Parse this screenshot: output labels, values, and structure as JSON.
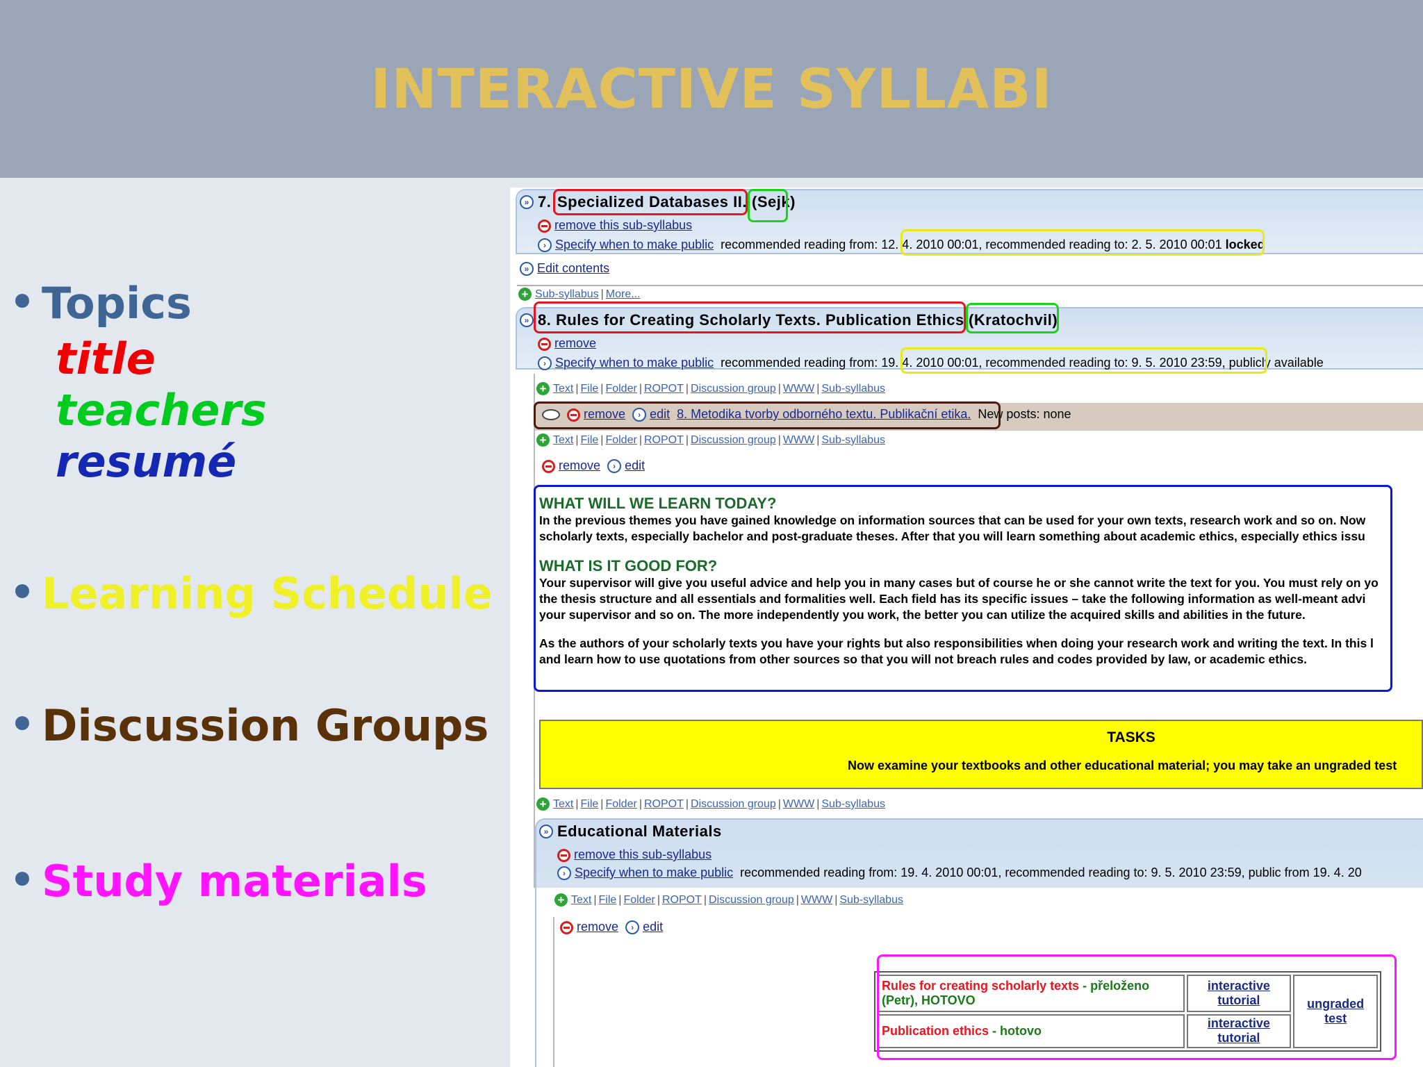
{
  "slide": {
    "title": "INTERACTIVE SYLLABI",
    "bullets": {
      "topics": "Topics",
      "topics_sub": [
        "title",
        "teachers",
        "resumé"
      ],
      "schedule": "Learning Schedule",
      "discussion": "Discussion Groups",
      "study": "Study materials"
    },
    "colors": {
      "header_bg": "#9aa6b7",
      "title": "#e2c15a",
      "topics": "#3e6594",
      "title_word": "#f00000",
      "teachers_word": "#00cc20",
      "resume_word": "#1428b4",
      "schedule": "#f0f028",
      "discussion": "#5a320a",
      "study": "#ff14ff"
    }
  },
  "screen": {
    "section7": {
      "number": "7.",
      "name": "Specialized Databases II.",
      "teacher": "(Sejk)",
      "remove": "remove this sub-syllabus",
      "specify": "Specify when to make public",
      "reading_label": "recommended reading from:",
      "reading_range": "12. 4. 2010 00:01, recommended reading to: 2. 5. 2010 00:01",
      "status": "locked",
      "edit_contents": "Edit contents",
      "sub_links": [
        "Sub-syllabus",
        "More..."
      ]
    },
    "section8": {
      "name": "8. Rules for Creating Scholarly Texts. Publication Ethics",
      "teacher": "(Kratochvil)",
      "remove": "remove",
      "specify": "Specify when to make public",
      "reading_label": "recommended reading from:",
      "reading_range": "19. 4. 2010 00:01, recommended reading to: 9. 5. 2010 23:59,",
      "status": "publicly available",
      "add_links": [
        "Text",
        "File",
        "Folder",
        "ROPOT",
        "Discussion group",
        "WWW",
        "Sub-syllabus"
      ],
      "discussion": {
        "remove": "remove",
        "edit": "edit",
        "topic": "8. Metodika tvorby odborného textu. Publikační etika.",
        "new_posts": "New posts: none"
      },
      "edit": "edit"
    },
    "learn": {
      "heading1": "WHAT WILL WE LEARN TODAY?",
      "p1": [
        "In the previous themes you have gained knowledge on information sources that can be used for your own texts, research work and so on. Now",
        "scholarly texts, especially bachelor and post-graduate theses. After that you will learn something about academic ethics, especially ethics issu"
      ],
      "heading2": "WHAT IS IT GOOD FOR?",
      "p2": [
        "Your supervisor will give you useful advice and help you in many cases but of course he or she cannot write the text for you. You must rely on yo",
        "the thesis structure and all essentials and formalities well. Each field has its specific issues – take the following information as well-meant advi",
        "your supervisor and so on. The more independently you work, the better you can utilize the acquired skills and abilities in the future."
      ],
      "p3": [
        "As the authors of your scholarly texts you have your rights but also responsibilities when doing your research work and writing the text. In this l",
        "and learn how to use quotations from other sources so that you will not breach rules and codes provided by law, or academic ethics."
      ]
    },
    "tasks": {
      "heading": "TASKS",
      "text": "Now examine your textbooks and other educational material; you may take an ungraded test"
    },
    "materials": {
      "name": "Educational Materials",
      "remove": "remove this sub-syllabus",
      "specify": "Specify when to make public",
      "reading": "recommended reading from: 19. 4. 2010 00:01, recommended reading to: 9. 5. 2010 23:59, public from 19. 4. 20",
      "remove_short": "remove",
      "edit": "edit",
      "table": {
        "row1_red": "Rules for creating scholarly texts",
        "row1_green": " - přeloženo",
        "row1_green2": "(Petr), HOTOVO",
        "row2_red": "Publication ethics",
        "row2_green": " - hotovo",
        "interactive": "interactive",
        "tutorial": "tutorial",
        "ungraded": "ungraded",
        "test": "test"
      }
    }
  }
}
